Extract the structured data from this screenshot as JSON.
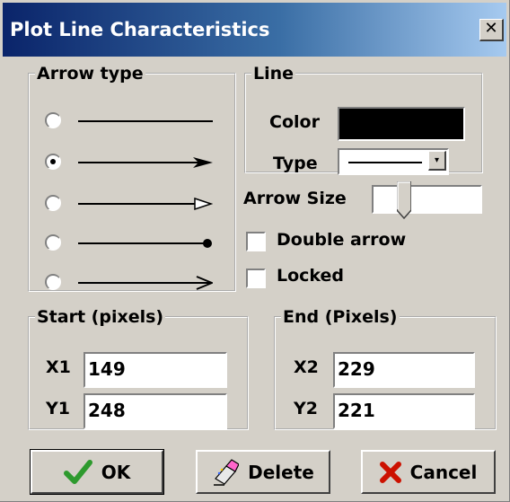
{
  "window": {
    "title": "Plot Line Characteristics",
    "close_glyph": "✕"
  },
  "arrow_type": {
    "legend": "Arrow type",
    "options": [
      {
        "style": "plain",
        "selected": false
      },
      {
        "style": "filled-triangle-head",
        "selected": true
      },
      {
        "style": "open-triangle-head",
        "selected": false
      },
      {
        "style": "dot-head",
        "selected": false
      },
      {
        "style": "line-arrow-head",
        "selected": false
      }
    ]
  },
  "line": {
    "legend": "Line",
    "color_label": "Color",
    "color_value": "#000000",
    "type_label": "Type",
    "type_value": "solid",
    "dropdown_glyph": "▾"
  },
  "arrow_size": {
    "label": "Arrow Size",
    "level": 0.3
  },
  "double_arrow": {
    "label": "Double arrow",
    "checked": false
  },
  "locked": {
    "label": "Locked",
    "checked": false
  },
  "start": {
    "legend": "Start (pixels)",
    "x_label": "X1",
    "x_value": "149",
    "y_label": "Y1",
    "y_value": "248"
  },
  "end": {
    "legend": "End (Pixels)",
    "x_label": "X2",
    "x_value": "229",
    "y_label": "Y2",
    "y_value": "221"
  },
  "buttons": {
    "ok": {
      "label": "OK",
      "icon": "checkmark-icon",
      "color": "#2e9a2e"
    },
    "delete": {
      "label": "Delete",
      "icon": "eraser-icon"
    },
    "cancel": {
      "label": "Cancel",
      "icon": "cross-icon",
      "color": "#cc1100"
    }
  }
}
